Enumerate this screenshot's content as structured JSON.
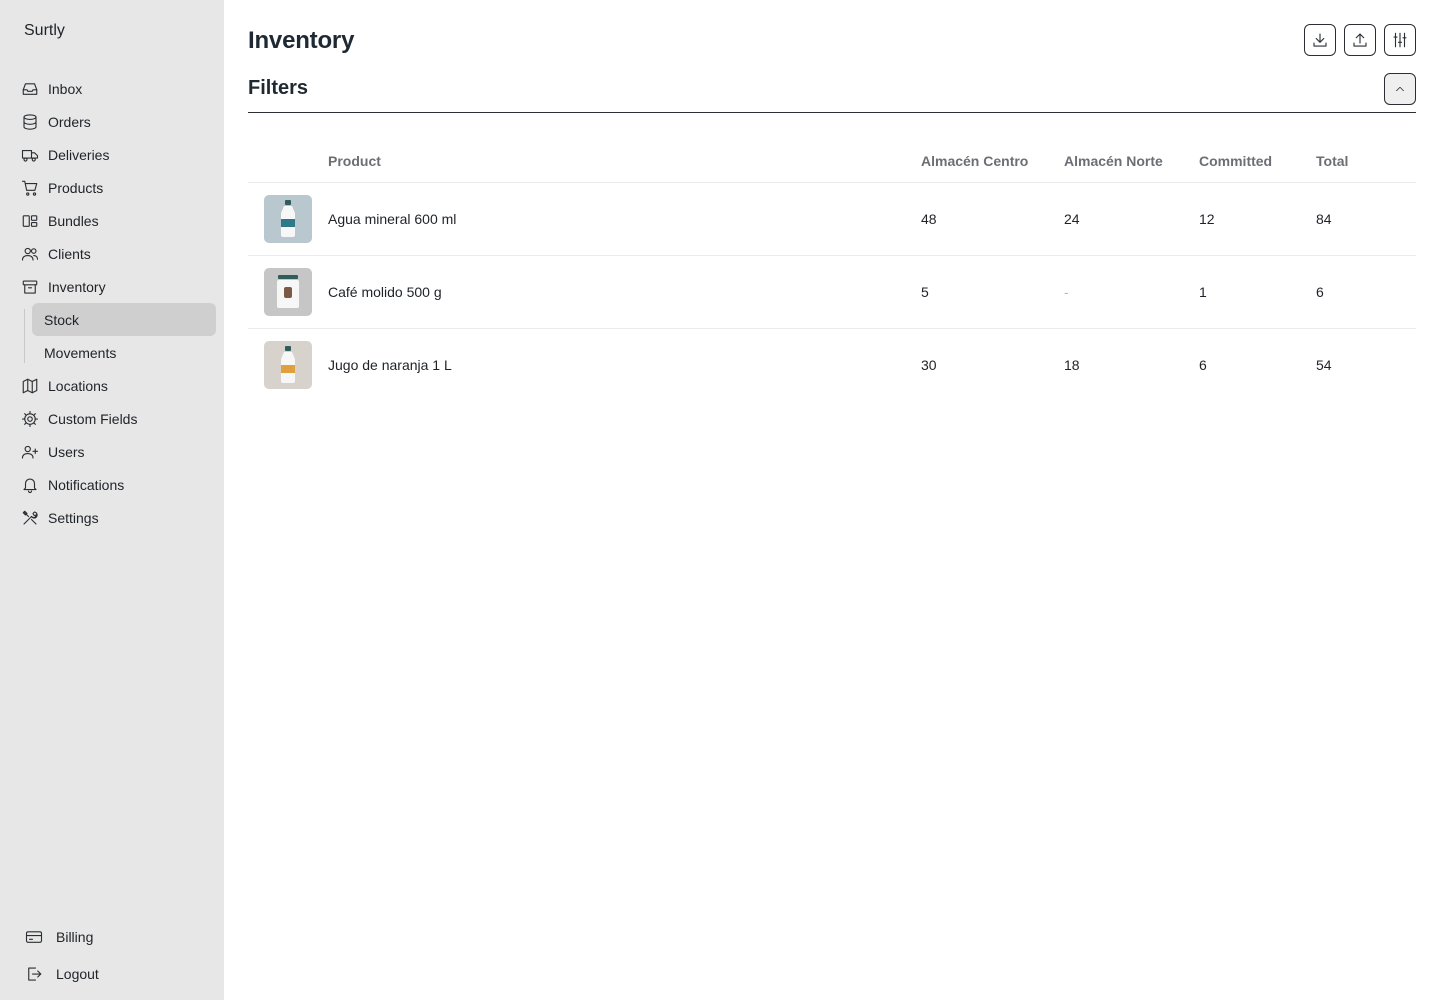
{
  "app": {
    "brand": "Surtly"
  },
  "sidebar": {
    "items": [
      {
        "label": "Inbox",
        "icon": "inbox-icon"
      },
      {
        "label": "Orders",
        "icon": "database-icon"
      },
      {
        "label": "Deliveries",
        "icon": "truck-icon"
      },
      {
        "label": "Products",
        "icon": "cart-icon"
      },
      {
        "label": "Bundles",
        "icon": "bundles-icon"
      },
      {
        "label": "Clients",
        "icon": "users-icon"
      },
      {
        "label": "Inventory",
        "icon": "archive-icon"
      }
    ],
    "inventory_sub": [
      {
        "label": "Stock",
        "active": true
      },
      {
        "label": "Movements",
        "active": false
      }
    ],
    "items_after": [
      {
        "label": "Locations",
        "icon": "map-icon"
      },
      {
        "label": "Custom Fields",
        "icon": "gear-icon"
      },
      {
        "label": "Users",
        "icon": "user-plus-icon"
      },
      {
        "label": "Notifications",
        "icon": "bell-icon"
      },
      {
        "label": "Settings",
        "icon": "tools-icon"
      }
    ],
    "bottom": [
      {
        "label": "Billing",
        "icon": "credit-card-icon"
      },
      {
        "label": "Logout",
        "icon": "logout-icon"
      }
    ]
  },
  "header": {
    "title": "Inventory"
  },
  "toolbar": {
    "icons": [
      "download-icon",
      "upload-icon",
      "sliders-icon"
    ]
  },
  "filters": {
    "title": "Filters",
    "collapse_icon": "chevron-up-icon"
  },
  "table": {
    "columns": [
      "Product",
      "Almacén Centro",
      "Almacén Norte",
      "Committed",
      "Total"
    ],
    "rows": [
      {
        "product": "Agua mineral 600 ml",
        "centro": "48",
        "norte": "24",
        "committed": "12",
        "total": "84",
        "thumb_bg": "#b9c7cf",
        "accent": "#2f7a8a"
      },
      {
        "product": "Café molido 500 g",
        "centro": "5",
        "norte": "-",
        "committed": "1",
        "total": "6",
        "thumb_bg": "#c6c6c6",
        "accent": "#7a5a46"
      },
      {
        "product": "Jugo de naranja 1 L",
        "centro": "30",
        "norte": "18",
        "committed": "6",
        "total": "54",
        "thumb_bg": "#d7d2cc",
        "accent": "#e0a040"
      }
    ]
  },
  "colors": {
    "sidebar_bg": "#e7e7e7",
    "active_bg": "#cfcfcf",
    "text": "#1f2328",
    "muted": "#6b6f74"
  }
}
